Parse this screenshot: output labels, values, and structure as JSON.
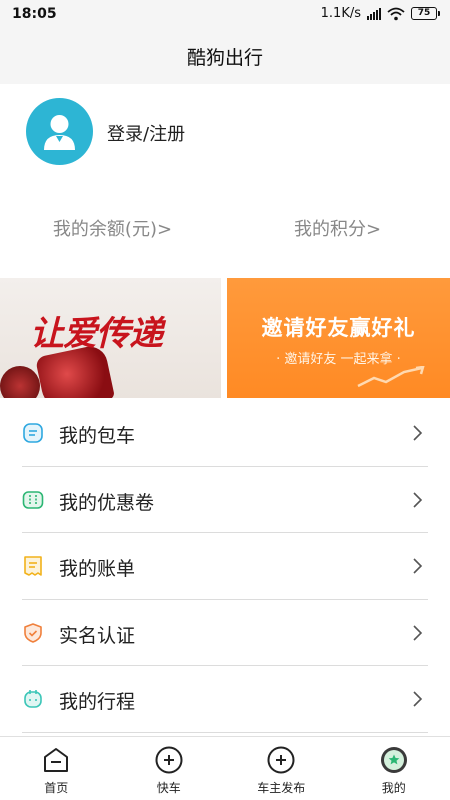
{
  "status_bar": {
    "time": "18:05",
    "network_speed": "1.1K/s",
    "battery": "75"
  },
  "app": {
    "title": "酷狗出行"
  },
  "profile": {
    "login_label": "登录/注册"
  },
  "stats": {
    "balance_label": "我的余额(元)>",
    "points_label": "我的积分>"
  },
  "banners": {
    "left": {
      "text": "让爱传递"
    },
    "right": {
      "title": "邀请好友赢好礼",
      "subtitle": "· 邀请好友 一起来拿 ·"
    }
  },
  "menu": {
    "items": [
      {
        "label": "我的包车",
        "icon": "charter-icon",
        "color": "#2fa8e0"
      },
      {
        "label": "我的优惠卷",
        "icon": "coupon-icon",
        "color": "#2bb673"
      },
      {
        "label": "我的账单",
        "icon": "bill-icon",
        "color": "#f2b21b"
      },
      {
        "label": "实名认证",
        "icon": "shield-icon",
        "color": "#f0803c"
      },
      {
        "label": "我的行程",
        "icon": "trip-icon",
        "color": "#3cc6b8"
      }
    ]
  },
  "tabbar": {
    "tabs": [
      {
        "label": "首页",
        "icon": "home-minus-icon"
      },
      {
        "label": "快车",
        "icon": "plus-circle-icon"
      },
      {
        "label": "车主发布",
        "icon": "plus-circle-icon"
      },
      {
        "label": "我的",
        "icon": "star-circle-icon",
        "active": true
      }
    ]
  }
}
